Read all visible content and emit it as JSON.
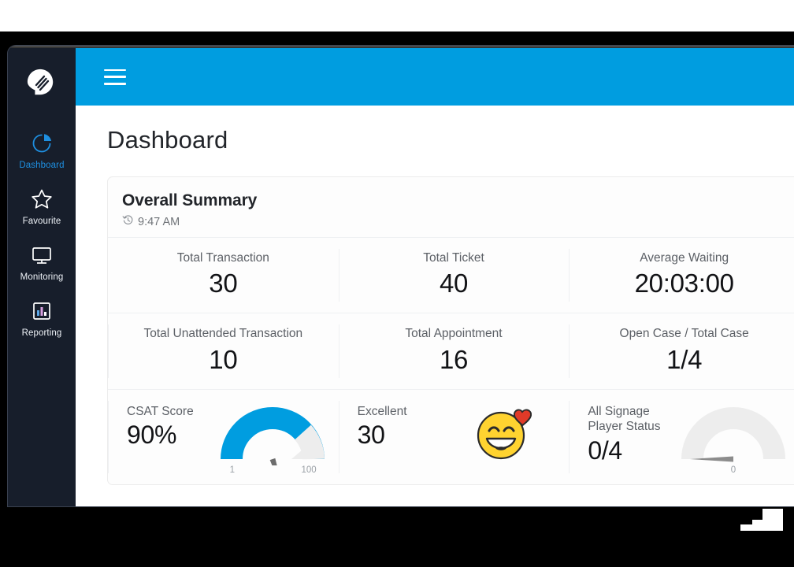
{
  "brand": {
    "icon": "app-logo-icon"
  },
  "sidebar": {
    "items": [
      {
        "label": "Dashboard",
        "icon": "pie-chart-icon",
        "active": true
      },
      {
        "label": "Favourite",
        "icon": "star-icon",
        "active": false
      },
      {
        "label": "Monitoring",
        "icon": "monitor-icon",
        "active": false
      },
      {
        "label": "Reporting",
        "icon": "bar-chart-icon",
        "active": false
      }
    ]
  },
  "topbar": {
    "menu_icon": "hamburger-menu-icon",
    "accent_color": "#009de0"
  },
  "page": {
    "title": "Dashboard"
  },
  "summary_card": {
    "title": "Overall Summary",
    "time": "9:47 AM",
    "time_icon": "history-clock-icon",
    "rows": [
      [
        {
          "label": "Total Transaction",
          "value": "30"
        },
        {
          "label": "Total Ticket",
          "value": "40"
        },
        {
          "label": "Average Waiting",
          "value": "20:03:00"
        }
      ],
      [
        {
          "label": "Total Unattended Transaction",
          "value": "10"
        },
        {
          "label": "Total Appointment",
          "value": "16"
        },
        {
          "label": "Open Case / Total Case",
          "value": "1/4"
        }
      ]
    ],
    "gauge_row": [
      {
        "label": "CSAT Score",
        "value": "90%",
        "visual": "gauge",
        "gauge": {
          "min_tick": "1",
          "max_tick": "100",
          "percent": 90,
          "fill_color": "#009de0",
          "track_color": "#ededed"
        }
      },
      {
        "label": "Excellent",
        "value": "30",
        "visual": "emoji",
        "emoji": {
          "name": "smiling-face-with-heart-icon",
          "face_color": "#ffd330",
          "heart_color": "#e03a28"
        }
      },
      {
        "label": "All Signage\nPlayer Status",
        "label_line1": "All Signage",
        "label_line2": "Player Status",
        "value": "0/4",
        "visual": "gauge",
        "gauge": {
          "min_tick": "0",
          "max_tick": "",
          "percent": 0,
          "fill_color": "#ededed",
          "track_color": "#ededed"
        }
      }
    ]
  }
}
